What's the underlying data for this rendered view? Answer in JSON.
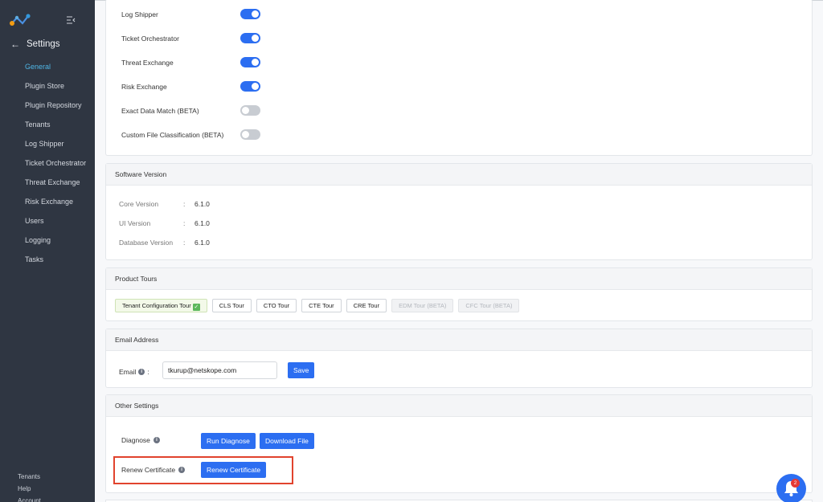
{
  "sidebar": {
    "title": "Settings",
    "items": [
      {
        "label": "General",
        "active": true
      },
      {
        "label": "Plugin Store"
      },
      {
        "label": "Plugin Repository"
      },
      {
        "label": "Tenants"
      },
      {
        "label": "Log Shipper"
      },
      {
        "label": "Ticket Orchestrator"
      },
      {
        "label": "Threat Exchange"
      },
      {
        "label": "Risk Exchange"
      },
      {
        "label": "Users"
      },
      {
        "label": "Logging"
      },
      {
        "label": "Tasks"
      }
    ],
    "bottom": [
      "Tenants",
      "Help",
      "Account"
    ]
  },
  "modules": [
    {
      "label": "Log Shipper",
      "enabled": true
    },
    {
      "label": "Ticket Orchestrator",
      "enabled": true
    },
    {
      "label": "Threat Exchange",
      "enabled": true
    },
    {
      "label": "Risk Exchange",
      "enabled": true
    },
    {
      "label": "Exact Data Match (BETA)",
      "enabled": false
    },
    {
      "label": "Custom File Classification (BETA)",
      "enabled": false
    }
  ],
  "version": {
    "header": "Software Version",
    "separator": ":",
    "rows": [
      {
        "key": "Core Version",
        "value": "6.1.0"
      },
      {
        "key": "UI Version",
        "value": "6.1.0"
      },
      {
        "key": "Database Version",
        "value": "6.1.0"
      }
    ]
  },
  "tours": {
    "header": "Product Tours",
    "items": [
      {
        "label": "Tenant Configuration Tour",
        "state": "done"
      },
      {
        "label": "CLS Tour",
        "state": "enabled"
      },
      {
        "label": "CTO Tour",
        "state": "enabled"
      },
      {
        "label": "CTE Tour",
        "state": "enabled"
      },
      {
        "label": "CRE Tour",
        "state": "enabled"
      },
      {
        "label": "EDM Tour (BETA)",
        "state": "disabled"
      },
      {
        "label": "CFC Tour (BETA)",
        "state": "disabled"
      }
    ]
  },
  "email": {
    "header": "Email Address",
    "label": "Email",
    "colon": ":",
    "value": "tkurup@netskope.com",
    "save_label": "Save"
  },
  "other": {
    "header": "Other Settings",
    "diagnose_label": "Diagnose",
    "run_label": "Run Diagnose",
    "download_label": "Download File",
    "renew_label": "Renew Certificate",
    "renew_button": "Renew Certificate"
  },
  "notifications": {
    "count": "2"
  },
  "colors": {
    "accent": "#2c6ef1",
    "sidebar": "#2f3642",
    "active_nav": "#4fb6e6",
    "highlight": "#e1432d"
  }
}
